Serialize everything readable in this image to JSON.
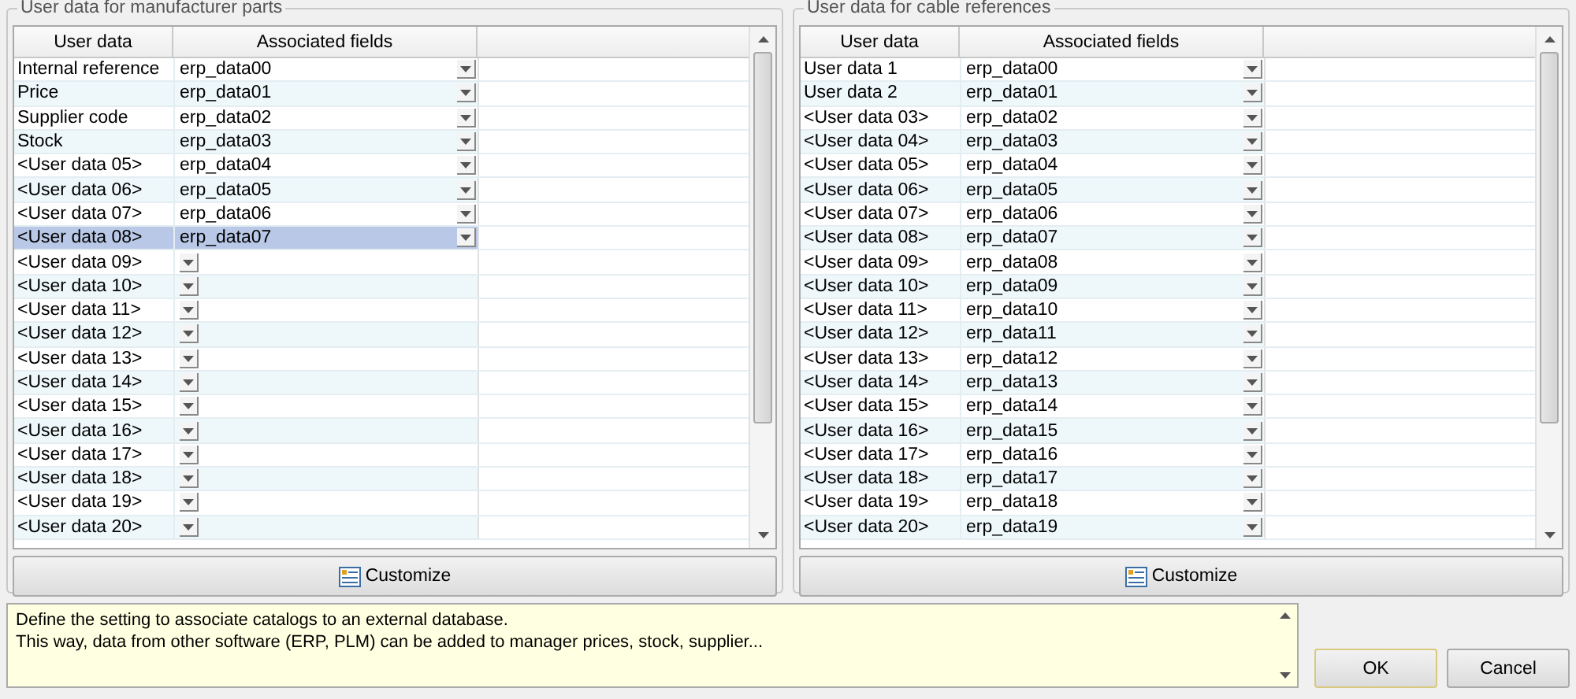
{
  "panels": [
    {
      "title": "User data for manufacturer parts",
      "columns": [
        "User data",
        "Associated fields"
      ],
      "rows": [
        {
          "user_data": "Internal reference",
          "field": "erp_data00",
          "selected": false
        },
        {
          "user_data": "Price",
          "field": "erp_data01",
          "selected": false
        },
        {
          "user_data": "Supplier code",
          "field": "erp_data02",
          "selected": false
        },
        {
          "user_data": "Stock",
          "field": "erp_data03",
          "selected": false
        },
        {
          "user_data": "<User data 05>",
          "field": "erp_data04",
          "selected": false
        },
        {
          "user_data": "<User data 06>",
          "field": "erp_data05",
          "selected": false
        },
        {
          "user_data": "<User data 07>",
          "field": "erp_data06",
          "selected": false
        },
        {
          "user_data": "<User data 08>",
          "field": "erp_data07",
          "selected": true
        },
        {
          "user_data": "<User data 09>",
          "selected": false
        },
        {
          "user_data": "<User data 10>",
          "selected": false
        },
        {
          "user_data": "<User data 11>",
          "selected": false
        },
        {
          "user_data": "<User data 12>",
          "selected": false
        },
        {
          "user_data": "<User data 13>",
          "selected": false
        },
        {
          "user_data": "<User data 14>",
          "selected": false
        },
        {
          "user_data": "<User data 15>",
          "selected": false
        },
        {
          "user_data": "<User data 16>",
          "selected": false
        },
        {
          "user_data": "<User data 17>",
          "selected": false
        },
        {
          "user_data": "<User data 18>",
          "selected": false
        },
        {
          "user_data": "<User data 19>",
          "selected": false
        },
        {
          "user_data": "<User data 20>",
          "selected": false
        }
      ],
      "button": "Customize"
    },
    {
      "title": "User data for cable references",
      "columns": [
        "User data",
        "Associated fields"
      ],
      "rows": [
        {
          "user_data": "User data 1",
          "field": "erp_data00",
          "selected": false
        },
        {
          "user_data": "User data 2",
          "field": "erp_data01",
          "selected": false
        },
        {
          "user_data": "<User data 03>",
          "field": "erp_data02",
          "selected": false
        },
        {
          "user_data": "<User data 04>",
          "field": "erp_data03",
          "selected": false
        },
        {
          "user_data": "<User data 05>",
          "field": "erp_data04",
          "selected": false
        },
        {
          "user_data": "<User data 06>",
          "field": "erp_data05",
          "selected": false
        },
        {
          "user_data": "<User data 07>",
          "field": "erp_data06",
          "selected": false
        },
        {
          "user_data": "<User data 08>",
          "field": "erp_data07",
          "selected": false
        },
        {
          "user_data": "<User data 09>",
          "field": "erp_data08",
          "selected": false
        },
        {
          "user_data": "<User data 10>",
          "field": "erp_data09",
          "selected": false
        },
        {
          "user_data": "<User data 11>",
          "field": "erp_data10",
          "selected": false
        },
        {
          "user_data": "<User data 12>",
          "field": "erp_data11",
          "selected": false
        },
        {
          "user_data": "<User data 13>",
          "field": "erp_data12",
          "selected": false
        },
        {
          "user_data": "<User data 14>",
          "field": "erp_data13",
          "selected": false
        },
        {
          "user_data": "<User data 15>",
          "field": "erp_data14",
          "selected": false
        },
        {
          "user_data": "<User data 16>",
          "field": "erp_data15",
          "selected": false
        },
        {
          "user_data": "<User data 17>",
          "field": "erp_data16",
          "selected": false
        },
        {
          "user_data": "<User data 18>",
          "field": "erp_data17",
          "selected": false
        },
        {
          "user_data": "<User data 19>",
          "field": "erp_data18",
          "selected": false
        },
        {
          "user_data": "<User data 20>",
          "field": "erp_data19",
          "selected": false
        }
      ],
      "button": "Customize"
    }
  ],
  "description": [
    "Define the setting to associate catalogs to an external database.",
    "This way, data from other software (ERP, PLM) can be added to manager prices, stock, supplier..."
  ],
  "buttons": [
    "OK",
    "Cancel"
  ]
}
